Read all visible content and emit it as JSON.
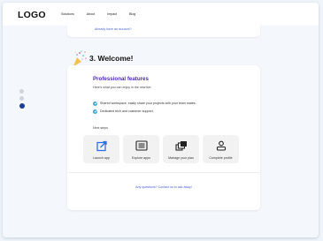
{
  "header": {
    "logo": "LOGO",
    "nav": [
      "Solutions",
      "About",
      "Impact",
      "Blog"
    ]
  },
  "prev_card": {
    "link": "Already have an account?"
  },
  "stepper": {
    "total": 3,
    "active": 3
  },
  "step": {
    "title": "3. Welcome!"
  },
  "card": {
    "title": "Professional features",
    "subtitle": "Here's what you can enjoy in the new tier:",
    "features": [
      "Shared workspace, easily share your projects with your team mates.",
      "Dedicated tech and customer support."
    ],
    "next_steps_label": "Next steps",
    "tiles": [
      {
        "label": "Launch app",
        "icon": "launch-icon"
      },
      {
        "label": "Explore apps",
        "icon": "apps-list-icon"
      },
      {
        "label": "Manage your plan",
        "icon": "plan-stack-icon"
      },
      {
        "label": "Complete profile",
        "icon": "profile-icon"
      }
    ],
    "contact": "Any questions? Contact us to ask away!"
  },
  "colors": {
    "accent": "#4f2bb8",
    "link": "#4b63d8",
    "check": "#3ea7d6",
    "icon_blue": "#2f6fe4"
  }
}
